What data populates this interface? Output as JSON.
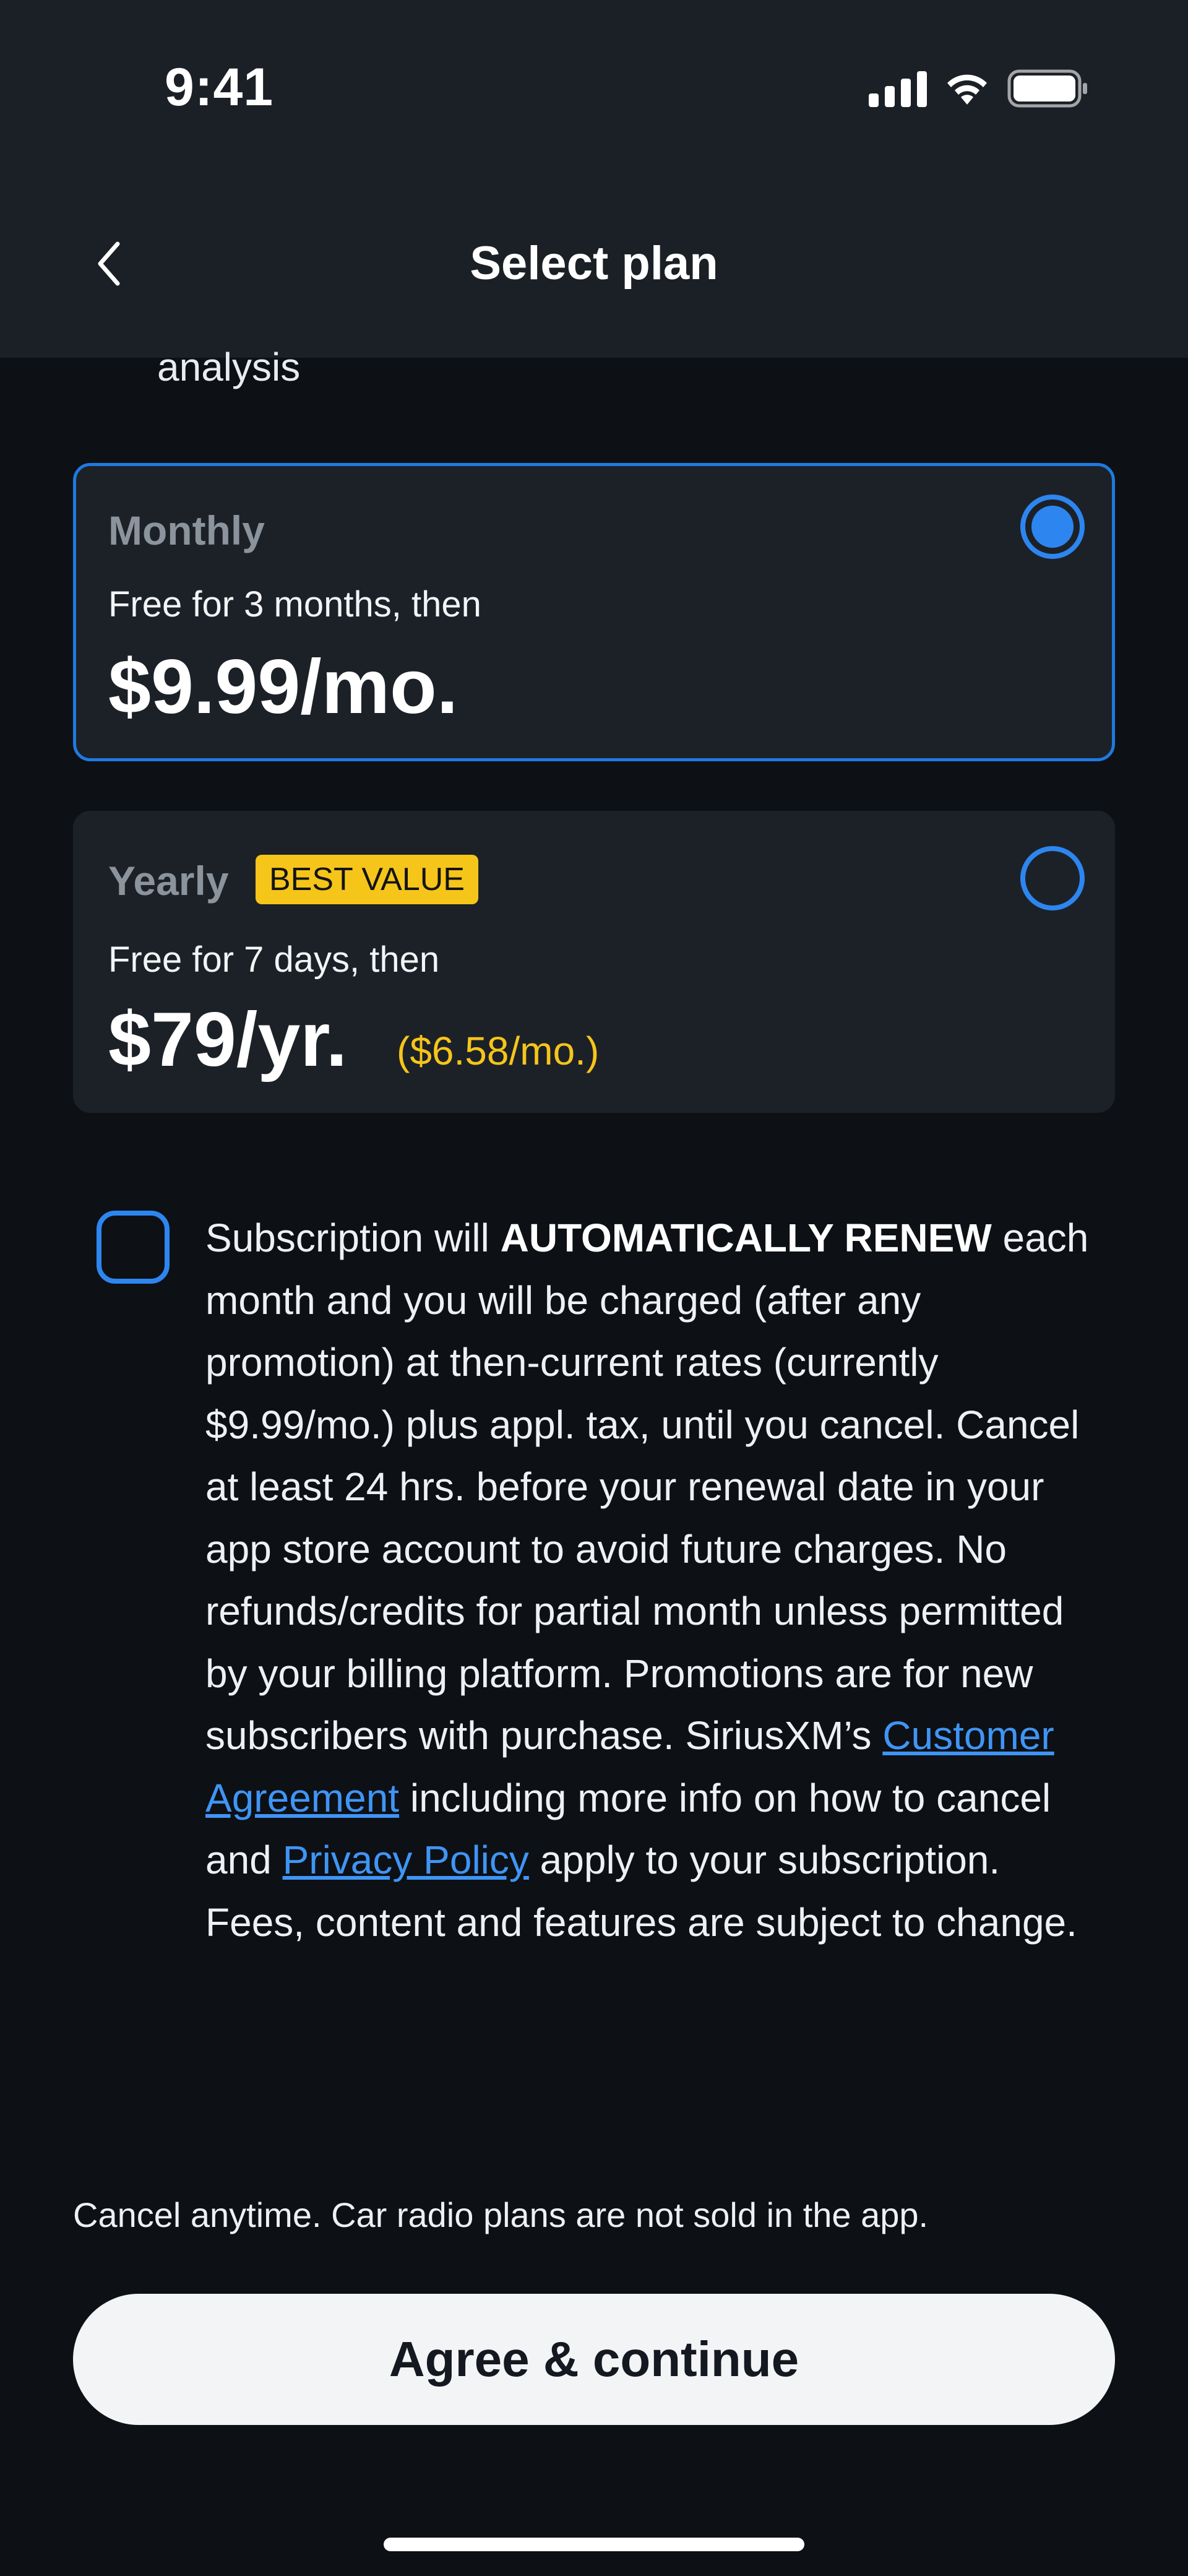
{
  "status_bar": {
    "time": "9:41"
  },
  "nav": {
    "title": "Select plan"
  },
  "content": {
    "cut_text": "analysis"
  },
  "plans": [
    {
      "name": "Monthly",
      "subtitle": "Free for 3 months, then",
      "price": "$9.99/mo.",
      "selected": true
    },
    {
      "name": "Yearly",
      "badge": "BEST VALUE",
      "subtitle": "Free for 7 days, then",
      "price": "$79/yr.",
      "per_month": "($6.58/mo.)",
      "selected": false
    }
  ],
  "terms": {
    "p1": "Subscription will ",
    "bold": "AUTOMATICALLY RENEW",
    "p2": " each month and you will be charged (after any promotion) at then-current rates (currently $9.99/mo.) plus appl. tax, until you cancel. Cancel at least 24 hrs. before your renewal date in your app store account to avoid future charges. No refunds/credits for partial month unless permitted by your billing platform. Promotions are for new subscribers with purchase. SiriusXM’s ",
    "link1": "Customer Agreement",
    "p3": " including more info on how to cancel and ",
    "link2": "Privacy Policy",
    "p4": " apply to your subscription. Fees, content and features are subject to change."
  },
  "footer": {
    "cancel_note": "Cancel anytime. Car radio plans are not sold in the app.",
    "cta_label": "Agree & continue"
  },
  "colors": {
    "accent": "#2d86f0",
    "badge": "#f6c51a",
    "background": "#0d1014",
    "header": "#1b2026",
    "card": "#1c2128"
  }
}
